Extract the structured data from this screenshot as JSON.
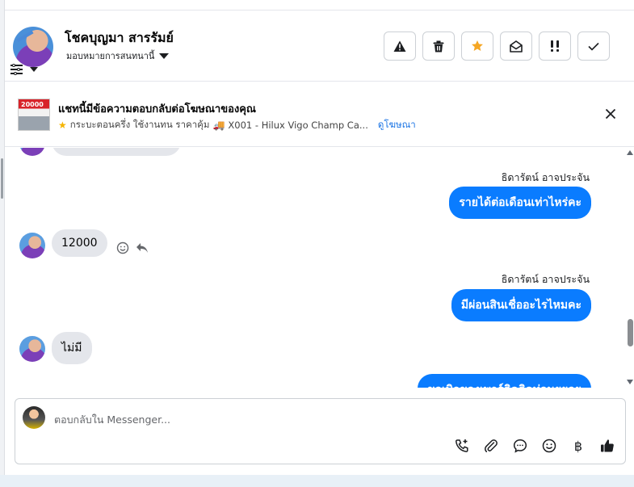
{
  "header": {
    "contact_name": "โชคบุญมา สารรัมย์",
    "assign_label": "มอบหมายการสนทนานี้",
    "actions": [
      "warning-icon",
      "trash-icon",
      "star-icon",
      "mark-unread-icon",
      "priority-icon",
      "done-check-icon"
    ]
  },
  "ad": {
    "title": "แชทนี้มีข้อความตอบกลับต่อโฆษณาของคุณ",
    "subtitle": "กระบะตอนครึ่ง ใช้งานทน ราคาคุ้ม",
    "product": "X001 - Hilux Vigo Champ Ca...",
    "link": "ดูโฆษณา",
    "thumb_text": "20000"
  },
  "messages": [
    {
      "side": "out",
      "sender": "ธิดารัตน์ อาจประจัน",
      "text": "รายได้ต่อเดือนเท่าไหร่คะ"
    },
    {
      "side": "in",
      "text": "12000"
    },
    {
      "side": "out",
      "sender": "ธิดารัตน์ อาจประจัน",
      "text": "มีผ่อนสินเชื่ออะไรไหมคะ"
    },
    {
      "side": "in",
      "text": "ไม่มี"
    },
    {
      "side": "out",
      "text": "ขอเบิกของเพาร์ติดติดท่อนยยอย"
    }
  ],
  "composer": {
    "placeholder": "ตอบกลับใน Messenger...",
    "tools": [
      "call-add-icon",
      "attach-icon",
      "saved-reply-icon",
      "emoji-icon",
      "baht-icon",
      "thumbs-up-icon"
    ]
  },
  "colors": {
    "accent": "#0a7cff",
    "star": "#f5a623",
    "link": "#1b74e4"
  }
}
